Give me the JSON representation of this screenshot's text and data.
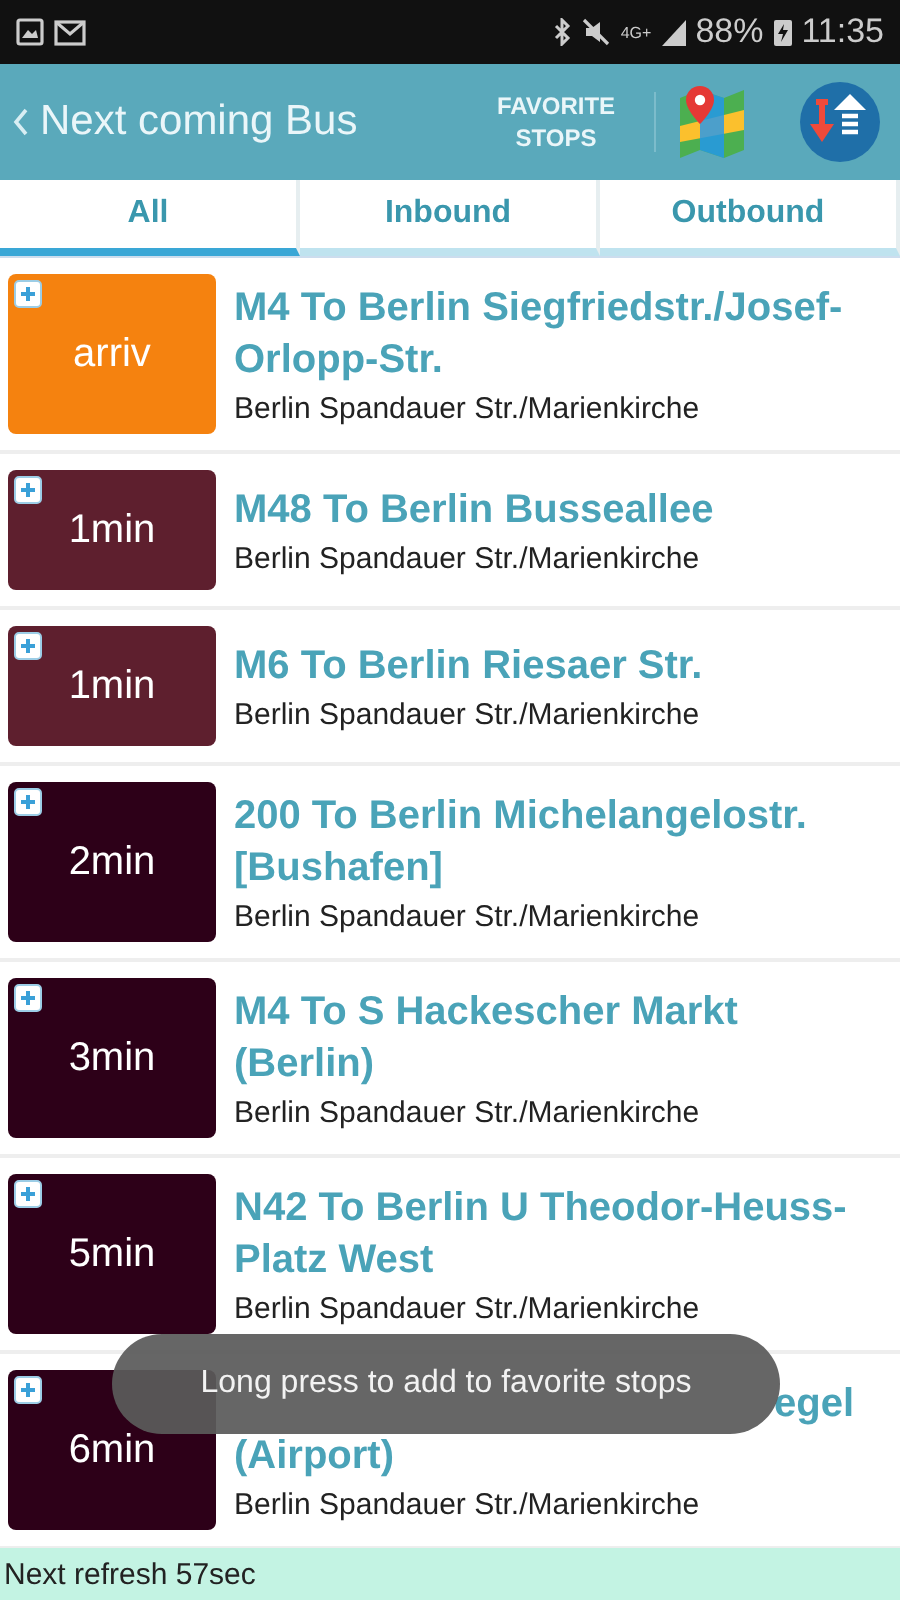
{
  "status_bar": {
    "battery": "88%",
    "time": "11:35",
    "network": "4G+"
  },
  "header": {
    "title": "Next coming Bus",
    "favorite_button": "FAVORITE STOPS"
  },
  "tabs": [
    {
      "label": "All",
      "selected": true
    },
    {
      "label": "Inbound",
      "selected": false
    },
    {
      "label": "Outbound",
      "selected": false
    }
  ],
  "arrivals": [
    {
      "kind": "full",
      "time": "arriv",
      "color": "#f5820f",
      "title": "M4 To Berlin Siegfriedstr./Josef-Orlopp-Str.",
      "stop": "Berlin Spandauer Str./Marienkirche"
    },
    {
      "kind": "full",
      "time": "1min",
      "color": "#5e1f2e",
      "title": "M48 To Berlin Busseallee",
      "stop": "Berlin Spandauer Str./Marienkirche"
    },
    {
      "kind": "full",
      "time": "1min",
      "color": "#5e1f2e",
      "title": "M6 To Berlin Riesaer Str.",
      "stop": "Berlin Spandauer Str./Marienkirche"
    },
    {
      "kind": "full",
      "time": "2min",
      "color": "#2d0018",
      "title": "200 To Berlin Michelangelostr. [Bushafen]",
      "stop": "Berlin Spandauer Str./Marienkirche"
    },
    {
      "kind": "full",
      "time": "3min",
      "color": "#2d0018",
      "title": "M4 To S Hackescher Markt (Berlin)",
      "stop": "Berlin Spandauer Str./Marienkirche"
    },
    {
      "kind": "full",
      "time": "5min",
      "color": "#2d0018",
      "title": "N42 To Berlin U Theodor-Heuss-Platz West",
      "stop": "Berlin Spandauer Str./Marienkirche"
    },
    {
      "kind": "covered",
      "time": "6min",
      "color": "#2d0018",
      "title_tail": "egel",
      "title_line2": "(Airport)",
      "stop": "Berlin Spandauer Str./Marienkirche"
    }
  ],
  "toast": "Long press to add to favorite stops",
  "footer": "Next refresh 57sec"
}
